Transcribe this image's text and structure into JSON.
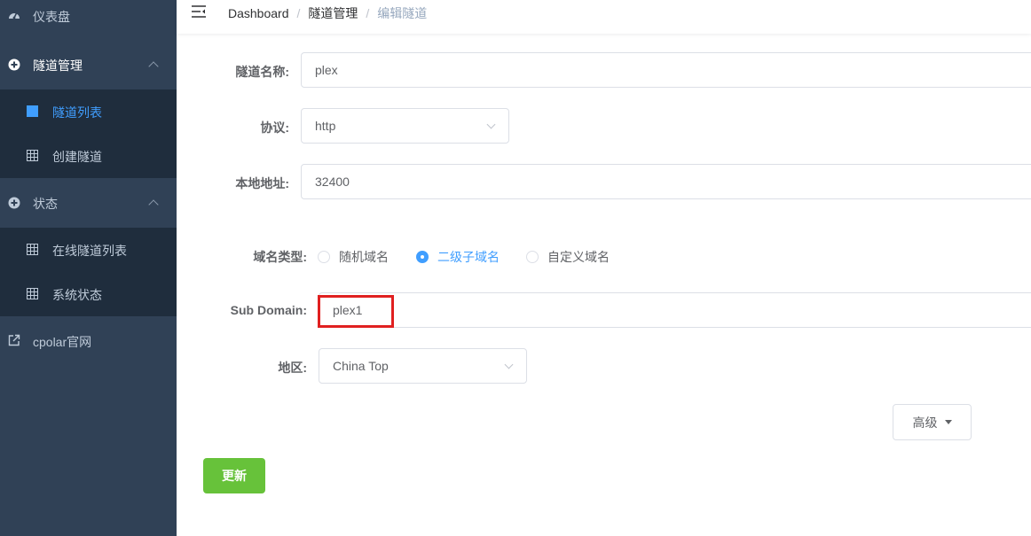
{
  "sidebar": {
    "dashboard_label": "仪表盘",
    "tunnel_mgmt_label": "隧道管理",
    "tunnel_list_label": "隧道列表",
    "create_tunnel_label": "创建隧道",
    "status_label": "状态",
    "online_tunnels_label": "在线隧道列表",
    "system_status_label": "系统状态",
    "cpolar_site_label": "cpolar官网",
    "active_item": "隧道列表"
  },
  "breadcrumb": {
    "items": [
      "Dashboard",
      "隧道管理",
      "编辑隧道"
    ],
    "separator": "/"
  },
  "form": {
    "tunnel_name_label": "隧道名称:",
    "tunnel_name_value": "plex",
    "protocol_label": "协议:",
    "protocol_value": "http",
    "local_addr_label": "本地地址:",
    "local_addr_value": "32400",
    "domain_type_label": "域名类型:",
    "domain_type_options": [
      "随机域名",
      "二级子域名",
      "自定义域名"
    ],
    "domain_type_selected": "二级子域名",
    "sub_domain_label": "Sub Domain:",
    "sub_domain_value": "plex1",
    "region_label": "地区:",
    "region_value": "China Top",
    "advanced_label": "高级",
    "update_label": "更新"
  },
  "colors": {
    "sidebar_bg": "#304156",
    "submenu_bg": "#1f2d3d",
    "active": "#409eff",
    "update_button": "#67c23a",
    "highlight": "#e02020"
  }
}
